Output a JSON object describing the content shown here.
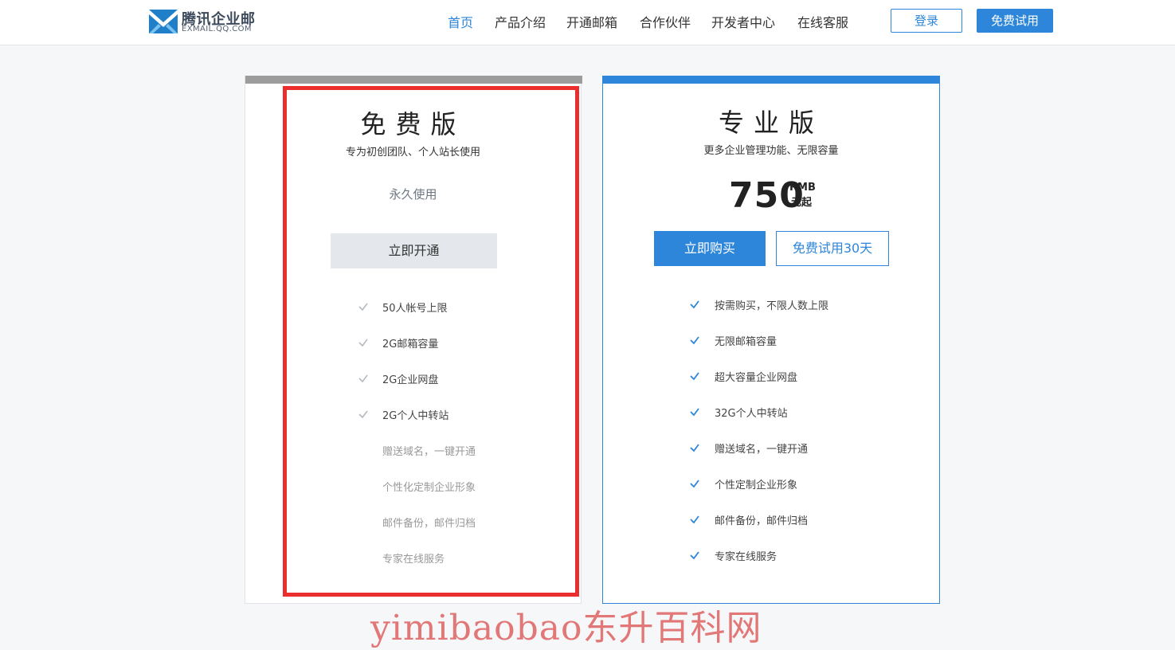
{
  "header": {
    "logo_cn": "腾讯企业邮",
    "logo_en": "EXMAIL.QQ.COM",
    "nav": [
      "首页",
      "产品介绍",
      "开通邮箱",
      "合作伙伴",
      "开发者中心",
      "在线客服"
    ],
    "login": "登录",
    "free_trial": "免费试用"
  },
  "free_plan": {
    "title": "免费版",
    "subtitle": "专为初创团队、个人站长使用",
    "duration": "永久使用",
    "button": "立即开通",
    "features": [
      {
        "text": "50人帐号上限",
        "included": true
      },
      {
        "text": "2G邮箱容量",
        "included": true
      },
      {
        "text": "2G企业网盘",
        "included": true
      },
      {
        "text": "2G个人中转站",
        "included": true
      },
      {
        "text": "赠送域名，一键开通",
        "included": false
      },
      {
        "text": "个性化定制企业形象",
        "included": false
      },
      {
        "text": "邮件备份，邮件归档",
        "included": false
      },
      {
        "text": "专家在线服务",
        "included": false
      }
    ]
  },
  "pro_plan": {
    "title": "专业版",
    "subtitle": "更多企业管理功能、无限容量",
    "price": "750",
    "currency": "RMB",
    "price_unit": "元起",
    "buy_button": "立即购买",
    "trial_button": "免费试用30天",
    "features": [
      "按需购买，不限人数上限",
      "无限邮箱容量",
      "超大容量企业网盘",
      "32G个人中转站",
      "赠送域名，一键开通",
      "个性定制企业形象",
      "邮件备份，邮件归档",
      "专家在线服务"
    ]
  },
  "watermark": "yimibaobao东升百科网",
  "colors": {
    "accent": "#2d86d9",
    "free_topbar": "#9c9c9c",
    "highlight": "#ea2d2d",
    "check_free": "#b5bac0",
    "check_pro": "#2d86d9"
  }
}
